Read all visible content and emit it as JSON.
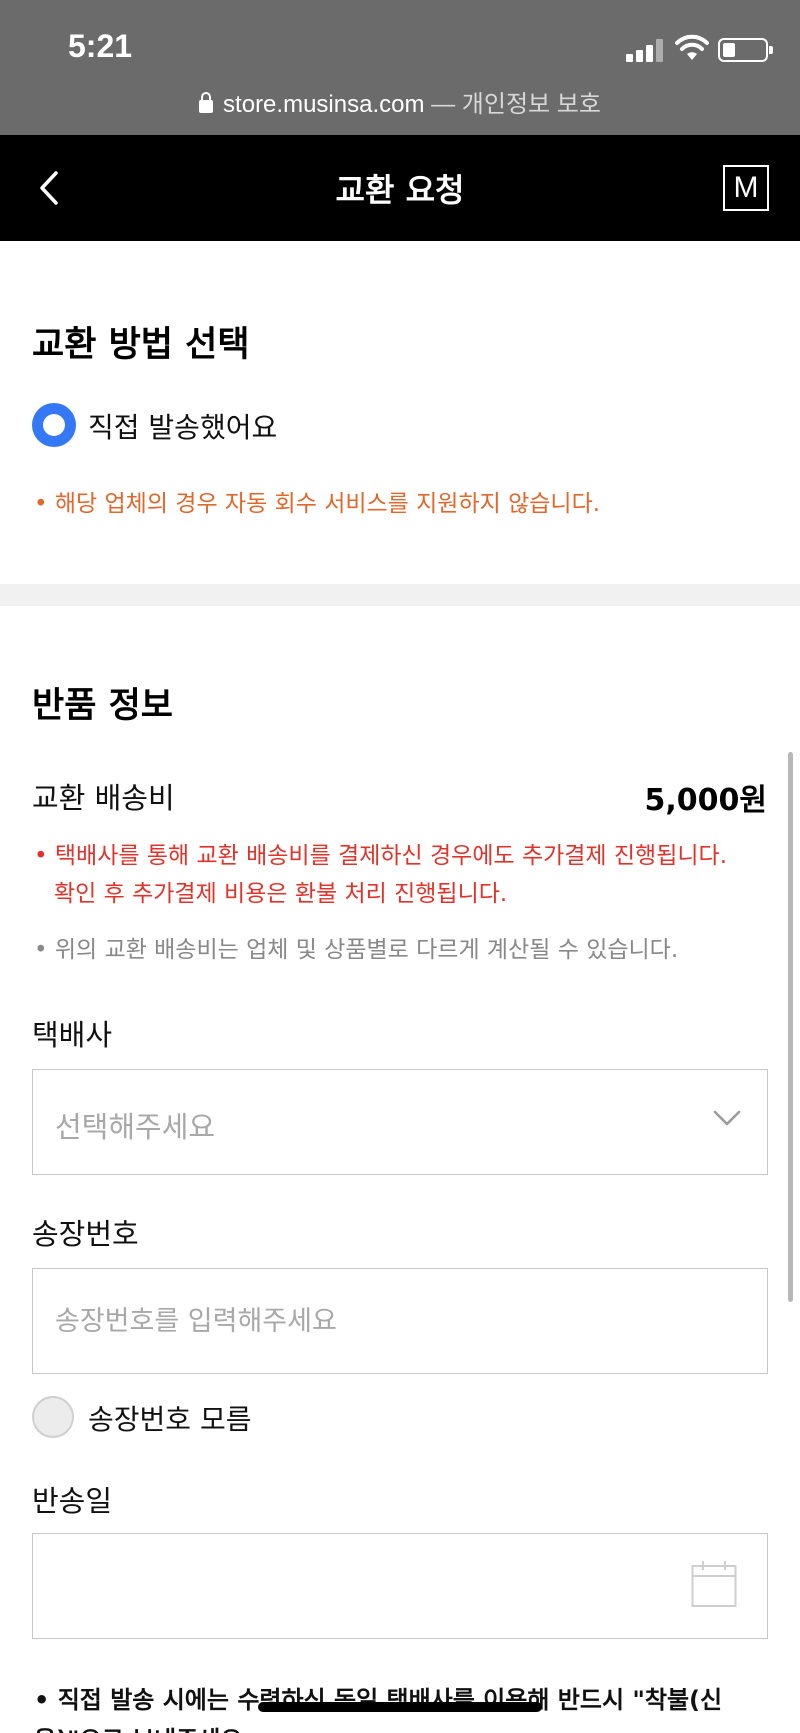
{
  "status_bar": {
    "time": "5:21",
    "url_host": "store.musinsa.com",
    "url_suffix": " — 개인정보 보호"
  },
  "nav": {
    "title": "교환 요청",
    "logo_text": "M"
  },
  "exchange_method": {
    "title": "교환 방법 선택",
    "option_label": "직접 발송했어요",
    "selected": true,
    "notice": "• 해당 업체의 경우 자동 회수 서비스를 지원하지 않습니다."
  },
  "return_info": {
    "title": "반품 정보",
    "fee_label": "교환 배송비",
    "fee_value": "5,000원",
    "notice_red_1": "• 택배사를 통해 교환 배송비를 결제하신 경우에도 추가결제 진행됩니다.",
    "notice_red_2": "확인 후 추가결제 비용은 환불 처리 진행됩니다.",
    "notice_gray": "• 위의 교환 배송비는 업체 및 상품별로 다르게 계산될 수 있습니다.",
    "courier_label": "택배사",
    "courier_placeholder": "선택해주세요",
    "invoice_label": "송장번호",
    "invoice_placeholder": "송장번호를 입력해주세요",
    "invoice_unknown_label": "송장번호 모름",
    "invoice_unknown_checked": false,
    "ship_date_label": "반송일",
    "ship_date_value": "",
    "footnote": "• 직접 발송 시에는 수령하신 동일 택배사를 이용해 반드시 \"착불(신용)\"으로 보내주세요."
  },
  "colors": {
    "accent_blue": "#3478f6",
    "notice_orange": "#e2672a",
    "notice_red": "#e2332a",
    "nav_background": "#000000",
    "status_background": "#6b6b6b"
  }
}
